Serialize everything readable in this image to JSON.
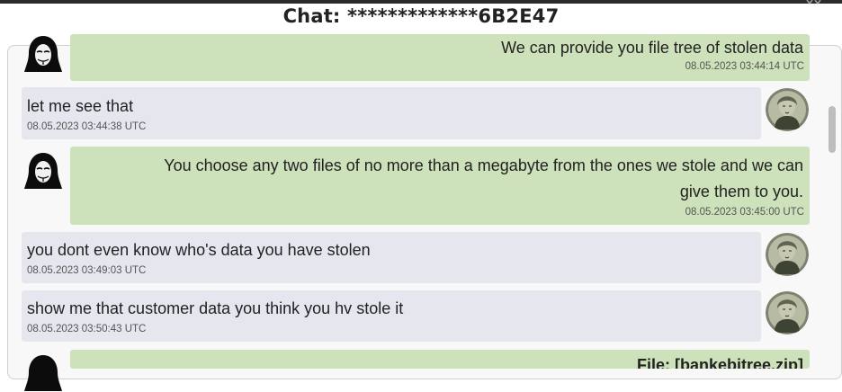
{
  "header": {
    "title": "Chat: *************6B2E47"
  },
  "messages": [
    {
      "sender": "attacker",
      "text": "We can provide you file tree of stolen data",
      "time": "08.05.2023 03:44:14 UTC"
    },
    {
      "sender": "victim",
      "text": "let me see that",
      "time": "08.05.2023 03:44:38 UTC"
    },
    {
      "sender": "attacker",
      "text_line1": "You choose any two files of no more than a megabyte from the ones we stole and we can",
      "text_line2": "give them to you.",
      "time": "08.05.2023 03:45:00 UTC"
    },
    {
      "sender": "victim",
      "text": "you dont even know who's data you have stolen",
      "time": "08.05.2023 03:49:03 UTC"
    },
    {
      "sender": "victim",
      "text": "show me that customer data you think you hv stole it",
      "time": "08.05.2023 03:50:43 UTC"
    },
    {
      "sender": "attacker",
      "text": "File: [bankebitree.zip]"
    }
  ],
  "colors": {
    "incoming_bubble": "#e6e6ef",
    "outgoing_bubble": "#cde1bb"
  },
  "icons": {
    "attacker_avatar": "hooded-hacker-icon",
    "victim_avatar": "banknote-portrait-icon"
  }
}
